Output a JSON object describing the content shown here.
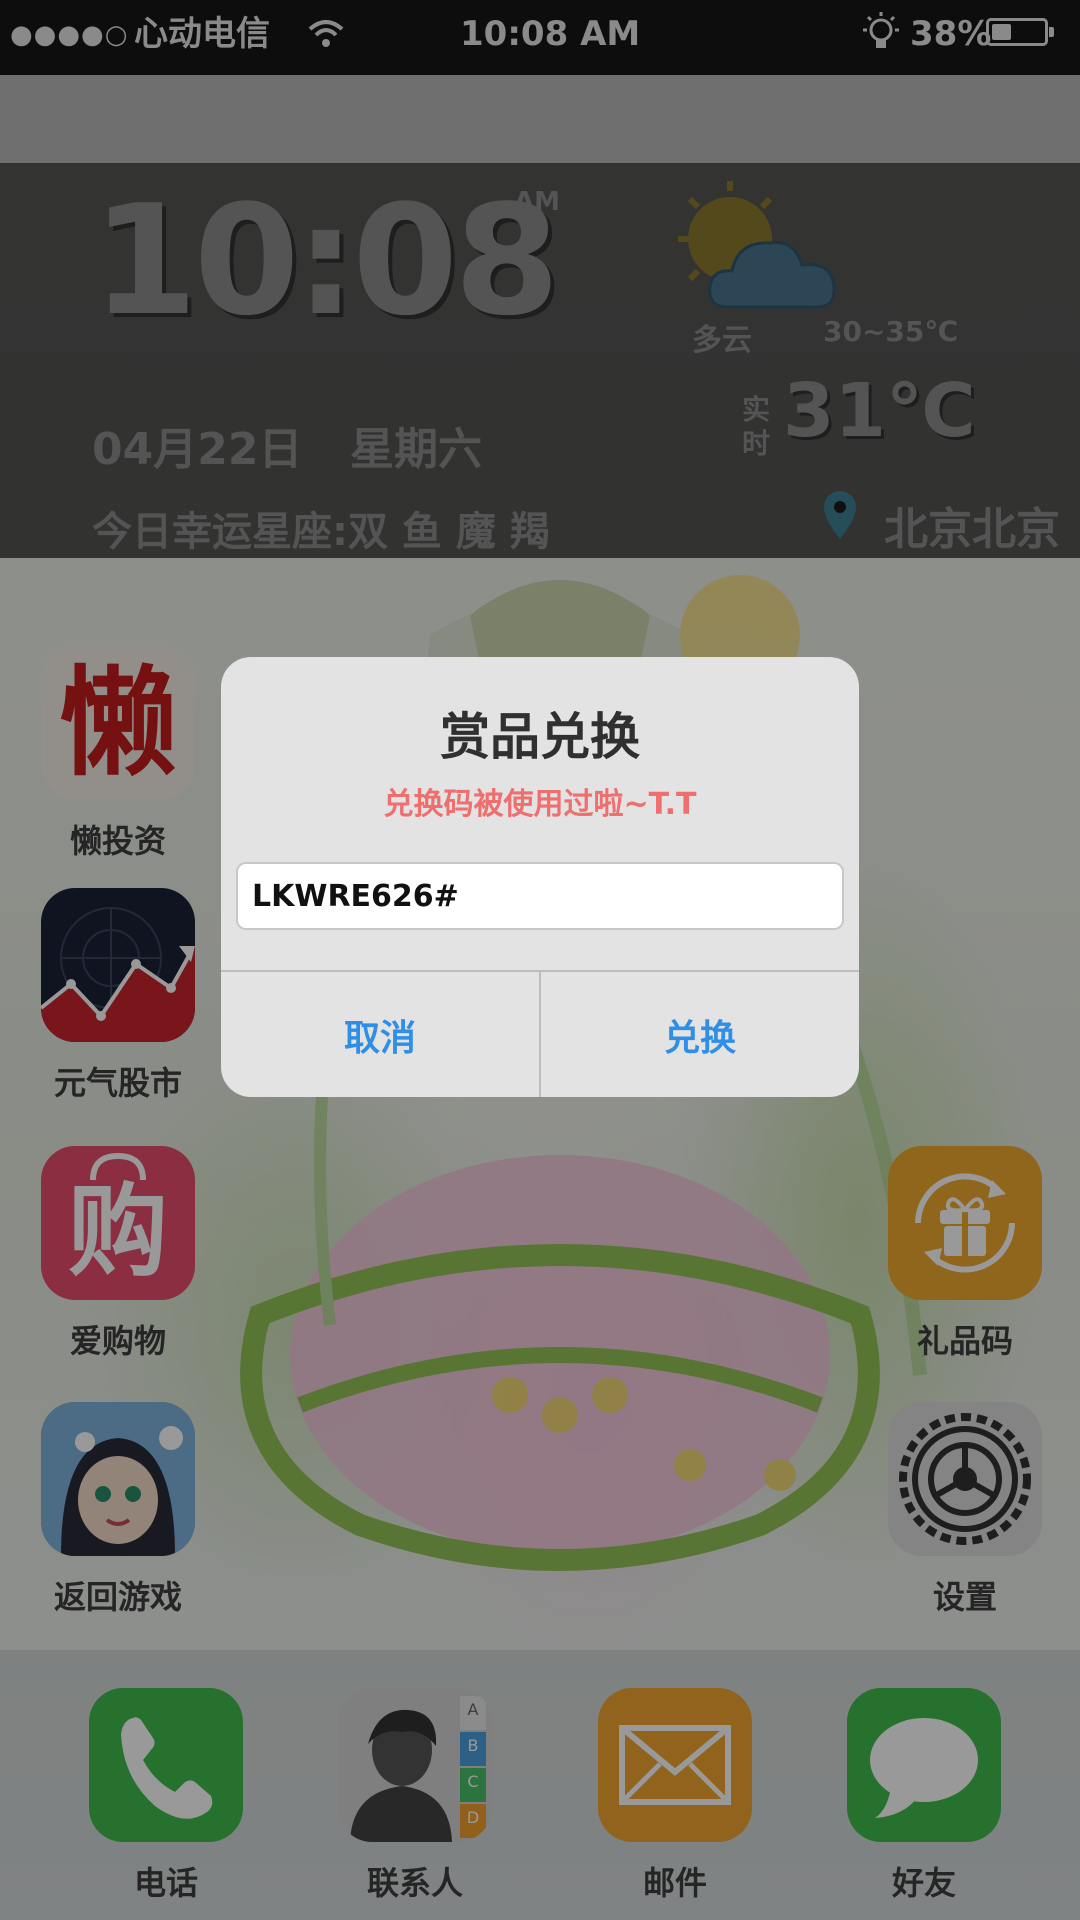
{
  "status_bar": {
    "signal": "●●●●○",
    "carrier": "心动电信",
    "time": "10:08 AM",
    "battery": "38%",
    "battery_level": 0.38,
    "icons": [
      "wifi-icon",
      "bulb-icon",
      "battery-icon"
    ]
  },
  "widget": {
    "clock": "10:08",
    "ampm": "AM",
    "weather_condition": "多云",
    "temp_range": "30~35℃",
    "realtime_label": "实时",
    "current_temp": "31℃",
    "date": "04月22日",
    "weekday": "星期六",
    "lucky_sign": "今日幸运星座:双 鱼 魔 羯",
    "city": "北京北京",
    "icons": [
      "partly-cloudy-icon",
      "location-pin-icon"
    ]
  },
  "apps": {
    "left": [
      {
        "label": "懒投资",
        "glyph": "懒",
        "icon": "lazy-invest-icon"
      },
      {
        "label": "元气股市",
        "icon": "stock-chart-icon"
      },
      {
        "label": "爱购物",
        "glyph": "购",
        "icon": "shopping-bag-icon"
      },
      {
        "label": "返回游戏",
        "icon": "game-avatar-icon"
      }
    ],
    "right": [
      {
        "label": "礼品码",
        "icon": "gift-code-icon"
      },
      {
        "label": "设置",
        "icon": "settings-gear-icon"
      }
    ]
  },
  "dock": [
    {
      "label": "电话",
      "icon": "phone-icon"
    },
    {
      "label": "联系人",
      "icon": "contacts-icon",
      "index_letters": [
        "A",
        "B",
        "C",
        "D"
      ]
    },
    {
      "label": "邮件",
      "icon": "mail-icon"
    },
    {
      "label": "好友",
      "icon": "messages-icon"
    }
  ],
  "dialog": {
    "title": "赏品兑换",
    "message": "兑换码被使用过啦~T.T",
    "code_value": "LKWRE626#",
    "cancel_label": "取消",
    "confirm_label": "兑换"
  },
  "colors": {
    "error_text": "#ef6e6e",
    "button_blue": "#2f8fe6",
    "dialog_bg": "#e3e3e3"
  }
}
